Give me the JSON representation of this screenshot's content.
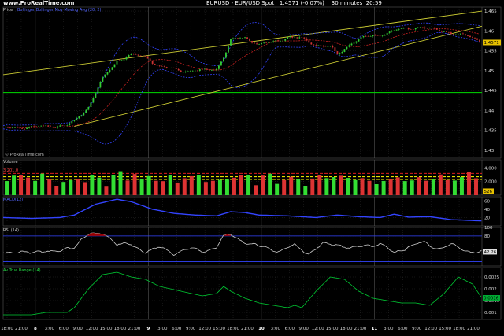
{
  "header": {
    "brand": "www.ProRealTime.com",
    "instrument": "EURUSD - EUR/USD Spot",
    "last": "1.4571 (-0.07%)",
    "timeframe": "30 minutes",
    "clock": "20:59"
  },
  "colors": {
    "background": "#000000",
    "bull_candle": "#33cc33",
    "bear_candle": "#cc3333",
    "channel": "#cccc33",
    "bollinger": "#3344ff",
    "moving_average": "#cc2222",
    "support_line": "#00dd00",
    "volume_bar_up": "#33dd33",
    "volume_bar_down": "#dd3333",
    "volume_level_lines": [
      "#ff2222",
      "#ffff00"
    ],
    "rsi_line": "#cccccc",
    "rsi_overbought_fill": "#990000",
    "atr_line": "#00cc33"
  },
  "panels": {
    "price": {
      "label": "Price",
      "legend": "Bollinger Bollinger Moy Moving Avg (20, 2)"
    },
    "volume": {
      "label": "Volume",
      "badge": "526",
      "level_label": "3,201.0"
    },
    "osc": {
      "label": "MACD(12)"
    },
    "rsi": {
      "label": "RSI (14)",
      "badge": "42.26"
    },
    "atr": {
      "label": "Av True Range (14)",
      "badge": "0.0016"
    },
    "watermark": "© ProRealTime.com"
  },
  "chart_data": [
    {
      "type": "candlestick",
      "title": "EURUSD - EUR/USD Spot",
      "y_ticks": [
        "1.43",
        "1.435",
        "1.44",
        "1.445",
        "1.45",
        "1.455",
        "1.46",
        "1.465"
      ],
      "ylim": [
        1.428,
        1.466
      ],
      "current_price": "1.4571",
      "support_level": 1.4445,
      "x_ticks": [
        "18:00",
        "21:00",
        "8",
        "3:00",
        "6:00",
        "9:00",
        "12:00",
        "15:00",
        "18:00",
        "21:00",
        "9",
        "3:00",
        "6:00",
        "9:00",
        "12:00",
        "15:00",
        "18:00",
        "21:00",
        "10",
        "3:00",
        "6:00",
        "9:00",
        "12:00",
        "15:00",
        "18:00",
        "21:00",
        "11",
        "3:00",
        "6:00",
        "9:00",
        "12:00",
        "15:00",
        "18:00",
        "21:00"
      ],
      "close_path": [
        [
          0,
          1.4355
        ],
        [
          9,
          1.4362
        ],
        [
          10,
          1.4372
        ],
        [
          12,
          1.441
        ],
        [
          14,
          1.448
        ],
        [
          16,
          1.4525
        ],
        [
          18,
          1.454
        ],
        [
          20,
          1.4535
        ],
        [
          22,
          1.451
        ],
        [
          25,
          1.45
        ],
        [
          28,
          1.45
        ],
        [
          30,
          1.4505
        ],
        [
          31,
          1.4535
        ],
        [
          32,
          1.4575
        ],
        [
          34,
          1.4585
        ],
        [
          36,
          1.4565
        ],
        [
          38,
          1.4572
        ],
        [
          40,
          1.4585
        ],
        [
          42,
          1.458
        ],
        [
          44,
          1.4565
        ],
        [
          46,
          1.456
        ],
        [
          47,
          1.454
        ],
        [
          49,
          1.457
        ],
        [
          51,
          1.4585
        ],
        [
          53,
          1.459
        ],
        [
          55,
          1.46
        ],
        [
          58,
          1.461
        ],
        [
          60,
          1.4605
        ],
        [
          62,
          1.46
        ],
        [
          64,
          1.459
        ],
        [
          66,
          1.4585
        ],
        [
          67.33,
          1.4571
        ]
      ]
    },
    {
      "type": "bar",
      "title": "Volume",
      "y_ticks": [
        "2,000",
        "4,000"
      ],
      "ylim": [
        0,
        5200
      ],
      "levels": [
        3201,
        2700,
        2300
      ],
      "last_value": 526
    },
    {
      "type": "line",
      "title": "MACD(12)",
      "y_ticks": [
        "20",
        "40",
        "60"
      ],
      "ylim": [
        0,
        70
      ],
      "path": [
        [
          0,
          20
        ],
        [
          4,
          18
        ],
        [
          8,
          20
        ],
        [
          10,
          26
        ],
        [
          13,
          52
        ],
        [
          16,
          64
        ],
        [
          18,
          58
        ],
        [
          21,
          40
        ],
        [
          24,
          30
        ],
        [
          27,
          26
        ],
        [
          30,
          24
        ],
        [
          32,
          34
        ],
        [
          34,
          32
        ],
        [
          36,
          26
        ],
        [
          40,
          24
        ],
        [
          44,
          20
        ],
        [
          47,
          26
        ],
        [
          50,
          22
        ],
        [
          53,
          20
        ],
        [
          55,
          28
        ],
        [
          57,
          21
        ],
        [
          60,
          22
        ],
        [
          63,
          15
        ],
        [
          67.33,
          12
        ]
      ]
    },
    {
      "type": "line",
      "title": "RSI (14)",
      "y_ticks": [
        "40",
        "80",
        "100"
      ],
      "ylim": [
        10,
        100
      ],
      "overbought": 80,
      "oversold": 20,
      "last_value": 42.26,
      "path": [
        [
          0,
          40
        ],
        [
          2,
          45
        ],
        [
          4,
          38
        ],
        [
          6,
          48
        ],
        [
          8,
          43
        ],
        [
          10,
          55
        ],
        [
          11,
          75
        ],
        [
          12,
          84
        ],
        [
          13,
          82
        ],
        [
          14,
          86
        ],
        [
          15,
          78
        ],
        [
          16,
          62
        ],
        [
          18,
          58
        ],
        [
          20,
          45
        ],
        [
          22,
          52
        ],
        [
          24,
          40
        ],
        [
          26,
          50
        ],
        [
          28,
          44
        ],
        [
          30,
          55
        ],
        [
          31,
          78
        ],
        [
          32,
          82
        ],
        [
          33,
          74
        ],
        [
          35,
          60
        ],
        [
          37,
          52
        ],
        [
          39,
          45
        ],
        [
          41,
          58
        ],
        [
          43,
          40
        ],
        [
          45,
          60
        ],
        [
          47,
          62
        ],
        [
          49,
          50
        ],
        [
          51,
          58
        ],
        [
          53,
          62
        ],
        [
          55,
          40
        ],
        [
          57,
          56
        ],
        [
          59,
          64
        ],
        [
          61,
          52
        ],
        [
          63,
          58
        ],
        [
          65,
          46
        ],
        [
          67.33,
          42.26
        ]
      ]
    },
    {
      "type": "line",
      "title": "Av True Range (14)",
      "y_ticks": [
        "0.001",
        "0.0015",
        "0.002",
        "0.0025"
      ],
      "ylim": [
        0.0007,
        0.0029
      ],
      "last_value": 0.0016,
      "path": [
        [
          0,
          0.0009
        ],
        [
          4,
          0.0009
        ],
        [
          6,
          0.001
        ],
        [
          9,
          0.001
        ],
        [
          10,
          0.0012
        ],
        [
          12,
          0.002
        ],
        [
          14,
          0.0026
        ],
        [
          16,
          0.0027
        ],
        [
          18,
          0.0025
        ],
        [
          20,
          0.0024
        ],
        [
          22,
          0.0021
        ],
        [
          25,
          0.0019
        ],
        [
          28,
          0.0017
        ],
        [
          30,
          0.0018
        ],
        [
          31,
          0.0021
        ],
        [
          32,
          0.0019
        ],
        [
          34,
          0.0016
        ],
        [
          36,
          0.0014
        ],
        [
          38,
          0.0013
        ],
        [
          40,
          0.0012
        ],
        [
          41,
          0.0013
        ],
        [
          42,
          0.0012
        ],
        [
          44,
          0.0019
        ],
        [
          46,
          0.0025
        ],
        [
          48,
          0.0024
        ],
        [
          50,
          0.0019
        ],
        [
          52,
          0.0016
        ],
        [
          54,
          0.0015
        ],
        [
          56,
          0.0014
        ],
        [
          58,
          0.0014
        ],
        [
          60,
          0.0013
        ],
        [
          62,
          0.0018
        ],
        [
          64,
          0.0025
        ],
        [
          66,
          0.0022
        ],
        [
          67.33,
          0.0016
        ]
      ]
    }
  ]
}
